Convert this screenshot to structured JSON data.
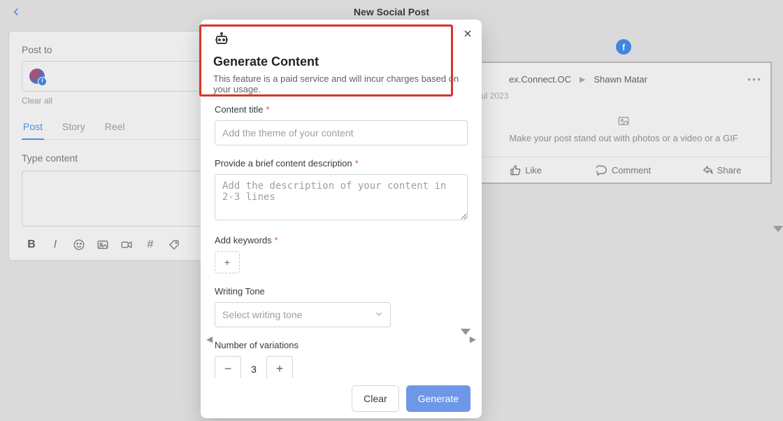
{
  "header": {
    "title": "New Social Post"
  },
  "left": {
    "post_to_label": "Post to",
    "clear_all": "Clear all",
    "tabs": {
      "post": "Post",
      "story": "Story",
      "reel": "Reel"
    },
    "type_content_label": "Type content",
    "toolbar": {
      "bold": "B",
      "italic": "I",
      "hash": "#"
    }
  },
  "preview": {
    "page_name": "ex.Connect.OC",
    "author": "Shawn Matar",
    "date": "ul 2023",
    "hint": "Make your post stand out with photos or a video or a GIF",
    "actions": {
      "like": "Like",
      "comment": "Comment",
      "share": "Share"
    }
  },
  "modal": {
    "title": "Generate Content",
    "subtitle": "This feature is a paid service and will incur charges based on your usage.",
    "content_title_label": "Content title",
    "content_title_placeholder": "Add the theme of your content",
    "desc_label": "Provide a brief content description",
    "desc_placeholder": "Add the description of your content in 2-3 lines",
    "keywords_label": "Add keywords",
    "tone_label": "Writing Tone",
    "tone_placeholder": "Select writing tone",
    "variations_label": "Number of variations",
    "variations_value": "3",
    "clear": "Clear",
    "generate": "Generate"
  }
}
